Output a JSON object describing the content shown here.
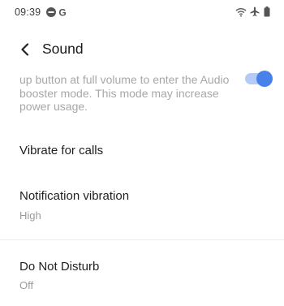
{
  "status_bar": {
    "time": "09:39",
    "left_icons": [
      "dnd-icon",
      "google-icon"
    ],
    "google_letter": "G",
    "right_icons": [
      "wifi-icon",
      "airplane-icon",
      "battery-icon"
    ]
  },
  "app_bar": {
    "title": "Sound",
    "back_icon": "back-arrow-icon"
  },
  "audio_booster": {
    "description": "up button at full volume to enter the Audio booster mode. This mode may increase power usage.",
    "toggle_on": true,
    "accent_color": "#2a6ce8"
  },
  "items": [
    {
      "title": "Vibrate for calls",
      "subtitle": ""
    },
    {
      "title": "Notification vibration",
      "subtitle": "High"
    },
    {
      "title": "Do Not Disturb",
      "subtitle": "Off"
    }
  ]
}
